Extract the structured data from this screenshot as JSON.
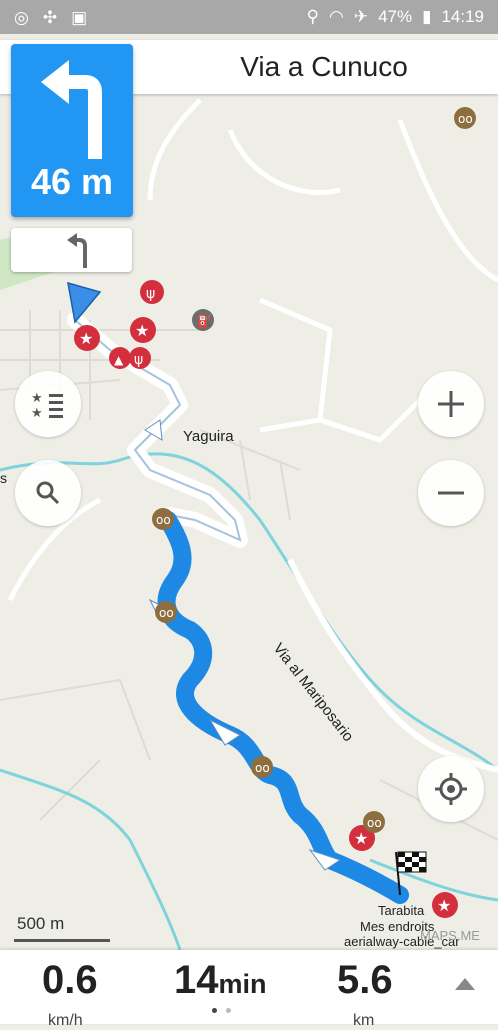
{
  "status_bar": {
    "battery": "47%",
    "time": "14:19"
  },
  "navigation": {
    "street_name": "Via a Cunuco",
    "turn_distance": "46 m"
  },
  "map": {
    "labels": {
      "town": "Yaguira",
      "road": "Via al Mariposario",
      "edge_letter": "s",
      "destination_name": "Tarabita",
      "destination_list": "Mes endroits",
      "destination_type": "aerialway-cable_car",
      "watermark": "MAPS.ME"
    },
    "scale": "500 m"
  },
  "trip": {
    "speed_value": "0.6",
    "speed_unit": "km/h",
    "time_value": "14",
    "time_unit": "min",
    "distance_value": "5.6",
    "distance_unit": "km"
  },
  "colors": {
    "route": "#1e88e5",
    "accent": "#2196f3",
    "poi": "#d32f3c",
    "viewpoint": "#8d6e3f"
  }
}
